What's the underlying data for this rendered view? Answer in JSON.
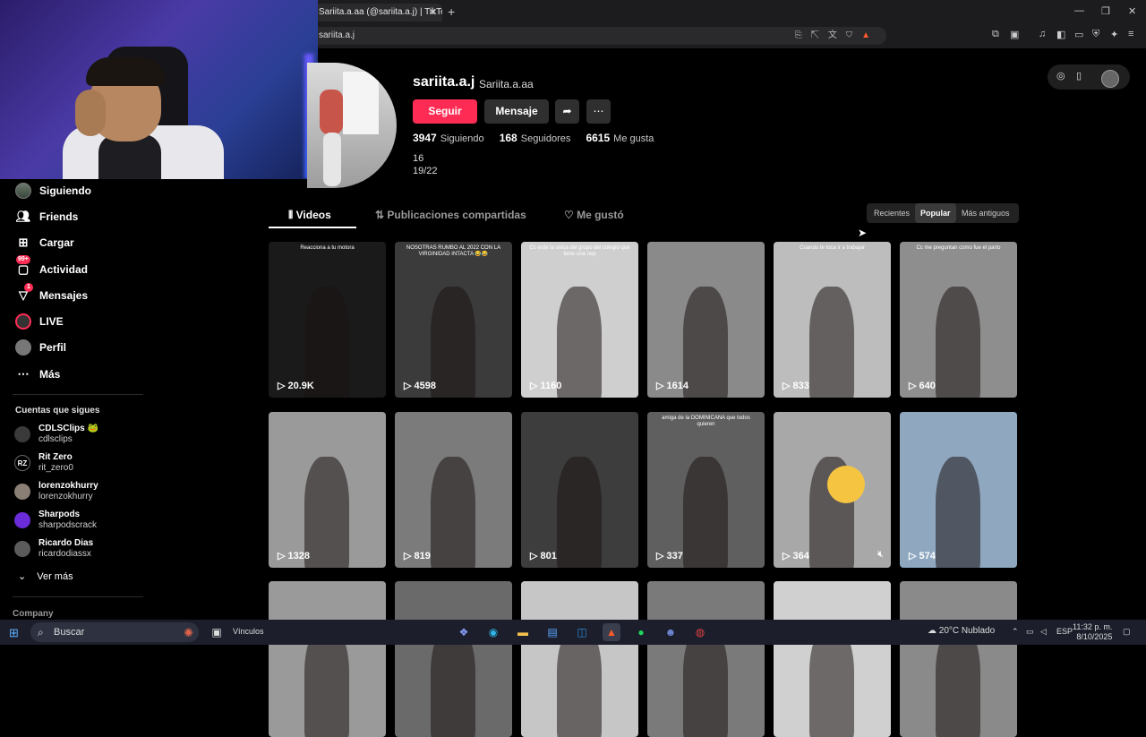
{
  "browser": {
    "tab_title": "Sariita.a.aa (@sariita.a.j) | TikTok",
    "tab_close": "✕",
    "new_tab": "+",
    "url": "sariita.a.j",
    "minimize": "—",
    "maximize": "❐",
    "close": "✕"
  },
  "sidebar": {
    "items": [
      {
        "label": "Siguiendo",
        "icon": "avatar-icon"
      },
      {
        "label": "Friends",
        "icon": "friends-icon"
      },
      {
        "label": "Cargar",
        "icon": "upload-icon"
      },
      {
        "label": "Actividad",
        "icon": "activity-icon",
        "badge": "99+"
      },
      {
        "label": "Mensajes",
        "icon": "messages-icon",
        "badge": "1"
      },
      {
        "label": "LIVE",
        "icon": "live-icon"
      },
      {
        "label": "Perfil",
        "icon": "profile-icon"
      },
      {
        "label": "Más",
        "icon": "more-icon"
      }
    ],
    "following_title": "Cuentas que sigues",
    "following": [
      {
        "name": "CDLSClips 🐸",
        "user": "cdlsclips",
        "avatar": ""
      },
      {
        "name": "Rit Zero",
        "user": "rit_zero0",
        "avatar": "RZ"
      },
      {
        "name": "lorenzokhurry",
        "user": "lorenzokhurry",
        "avatar": ""
      },
      {
        "name": "Sharpods",
        "user": "sharpodscrack",
        "avatar": ""
      },
      {
        "name": "Ricardo Dias",
        "user": "ricardodiassx",
        "avatar": ""
      }
    ],
    "see_more": "Ver más",
    "company": "Company"
  },
  "profile": {
    "username": "sariita.a.j",
    "nickname": "Sariita.a.aa",
    "follow_label": "Seguir",
    "message_label": "Mensaje",
    "following_count": "3947",
    "following_label": "Siguiendo",
    "followers_count": "168",
    "followers_label": "Seguidores",
    "likes_count": "6615",
    "likes_label": "Me gusta",
    "bio_line1": "16",
    "bio_line2": "19/22"
  },
  "tabs": {
    "videos": "Videos",
    "reposts": "Publicaciones compartidas",
    "liked": "Me gustó"
  },
  "sort": {
    "recent": "Recientes",
    "popular": "Popular",
    "oldest": "Más antiguos"
  },
  "videos": [
    {
      "views": "20.9K",
      "caption": "Reacciona a tu motora",
      "bg": "#1a1a1a"
    },
    {
      "views": "4598",
      "caption": "NOSOTRAS RUMBO AL 2022 CON LA VIRGINIDAD INTACTA 😂😂",
      "bg": "#3b3b3b"
    },
    {
      "views": "1160",
      "caption": "Cc erde la unica del grupo del colegio que tiene una nep",
      "bg": "#cfcfcf"
    },
    {
      "views": "1614",
      "caption": "",
      "bg": "#8a8a8a"
    },
    {
      "views": "833",
      "caption": "Cuando te toca ir a trabajar",
      "bg": "#bdbdbd"
    },
    {
      "views": "640",
      "caption": "Cc me preguntan como fue el parto",
      "bg": "#8e8e8e"
    },
    {
      "views": "1328",
      "caption": "",
      "bg": "#9a9a9a"
    },
    {
      "views": "819",
      "caption": "",
      "bg": "#7b7b7b"
    },
    {
      "views": "801",
      "caption": "",
      "bg": "#3d3d3d"
    },
    {
      "views": "337",
      "caption": "amiga de la DOMINICANA que todos quieren",
      "bg": "#5f5f5f"
    },
    {
      "views": "364",
      "caption": "",
      "bg": "#a8a8a8"
    },
    {
      "views": "574",
      "caption": "",
      "bg": "#8fa8c0"
    },
    {
      "views": "",
      "caption": "",
      "bg": "#9a9a9a"
    },
    {
      "views": "",
      "caption": "",
      "bg": "#6a6a6a"
    },
    {
      "views": "",
      "caption": "",
      "bg": "#c6c6c6"
    },
    {
      "views": "",
      "caption": "",
      "bg": "#7a7a7a"
    },
    {
      "views": "",
      "caption": "",
      "bg": "#d0d0d0"
    },
    {
      "views": "",
      "caption": "",
      "bg": "#8a8a8a"
    }
  ],
  "taskbar": {
    "search": "Buscar",
    "vinculos": "Vínculos",
    "weather": "20°C  Nublado",
    "lang": "ESP",
    "time": "11:32 p. m.",
    "date": "8/10/2025"
  }
}
